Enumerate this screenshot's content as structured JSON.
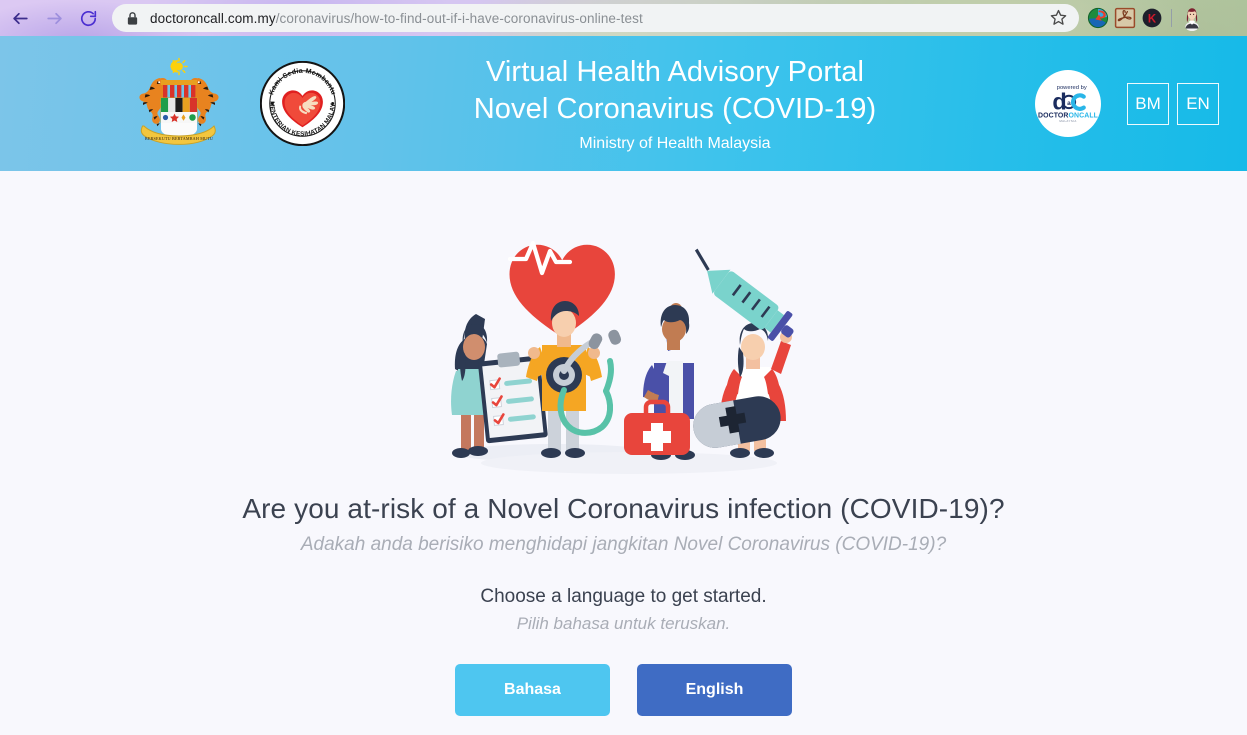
{
  "browser": {
    "back_icon": "back-arrow-icon",
    "forward_icon": "forward-arrow-icon",
    "reload_icon": "reload-icon",
    "lock_icon": "lock-icon",
    "url_domain": "doctoroncall.com.my",
    "url_path": "/coronavirus/how-to-find-out-if-i-have-coronavirus-online-test",
    "url_full": "doctoroncall.com.my/coronavirus/how-to-find-out-if-i-have-coronavirus-online-test",
    "star_icon": "bookmark-star-icon",
    "extensions": [
      {
        "name": "idm-extension-icon",
        "label": "IDM"
      },
      {
        "name": "adobe-acrobat-extension-icon",
        "label": "Adobe Acrobat"
      },
      {
        "name": "kaspersky-extension-icon",
        "label": "K"
      }
    ],
    "avatar_icon": "profile-avatar-icon"
  },
  "header": {
    "crest_icon": "malaysia-coat-of-arms-icon",
    "moh_icon": "ministry-of-health-malaysia-logo-icon",
    "moh_motto": "Kami Sedia Membantu",
    "moh_ring_text": "KEMENTERIAN KESIHATAN MALAYSIA",
    "title_line1": "Virtual Health Advisory Portal",
    "title_line2": "Novel Coronavirus (COVID-19)",
    "subtitle": "Ministry of Health Malaysia",
    "doc_badge": {
      "icon": "doctoroncall-logo-icon",
      "powered_by": "powered by",
      "wordmark": "doc",
      "brand": "DOCTORONCALL"
    },
    "lang_buttons": [
      {
        "name": "lang-button-bm",
        "label": "BM"
      },
      {
        "name": "lang-button-en",
        "label": "EN"
      }
    ],
    "colors": {
      "gradient_start": "#7cc5e9",
      "gradient_end": "#16bae8",
      "text": "#ffffff"
    }
  },
  "main": {
    "illustration_icon": "medical-team-illustration",
    "headline": "Are you at-risk of a Novel Coronavirus infection (COVID-19)?",
    "headline_my": "Adakah anda berisiko menghidapi jangkitan Novel Coronavirus (COVID-19)?",
    "prompt": "Choose a language to get started.",
    "prompt_my": "Pilih bahasa untuk teruskan.",
    "buttons": [
      {
        "name": "choose-bahasa-button",
        "label": "Bahasa",
        "color": "#4ec6f0"
      },
      {
        "name": "choose-english-button",
        "label": "English",
        "color": "#3f6cc4"
      }
    ],
    "background": "#f8f8fd"
  }
}
